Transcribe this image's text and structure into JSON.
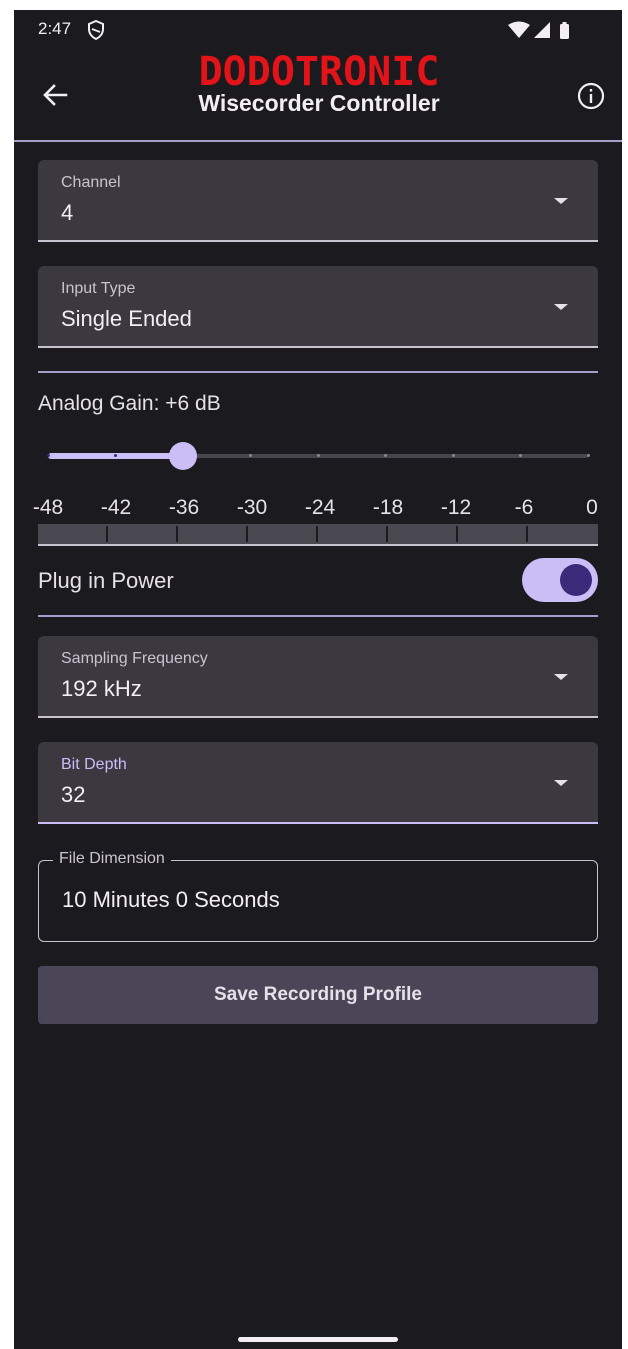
{
  "status_bar": {
    "time": "2:47"
  },
  "app_bar": {
    "brand": "DODOTRONIC",
    "title": "Wisecorder Controller"
  },
  "form": {
    "channel": {
      "label": "Channel",
      "value": "4"
    },
    "input_type": {
      "label": "Input Type",
      "value": "Single Ended"
    },
    "analog_gain": {
      "label": "Analog Gain: +6 dB",
      "scale_labels": [
        "-48",
        "-42",
        "-36",
        "-30",
        "-24",
        "-18",
        "-12",
        "-6",
        "0"
      ],
      "slider_fraction": 0.25
    },
    "plug_in_power": {
      "label": "Plug in Power",
      "enabled": true
    },
    "sampling_frequency": {
      "label": "Sampling Frequency",
      "value": "192 kHz"
    },
    "bit_depth": {
      "label": "Bit Depth",
      "value": "32"
    },
    "file_dimension": {
      "label": "File Dimension",
      "value": "10 Minutes 0 Seconds"
    },
    "save_label": "Save Recording Profile"
  },
  "colors": {
    "background": "#1b1a1f",
    "surface": "#3b3840",
    "accent": "#cbbdf6",
    "brand_red": "#e3131a"
  }
}
